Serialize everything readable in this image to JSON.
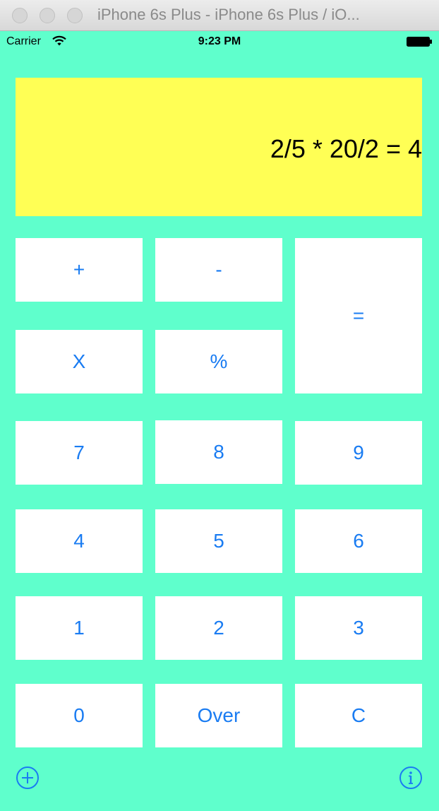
{
  "window": {
    "title": "iPhone 6s Plus - iPhone 6s Plus / iO..."
  },
  "status_bar": {
    "carrier": "Carrier",
    "time": "9:23 PM",
    "icons": [
      "wifi-icon",
      "battery-icon"
    ]
  },
  "display": {
    "expression": "2/5 * 20/2 = 4"
  },
  "keys": {
    "plus": "+",
    "minus": "-",
    "equals": "=",
    "multiply": "X",
    "percent": "%",
    "seven": "7",
    "eight": "8",
    "nine": "9",
    "four": "4",
    "five": "5",
    "six": "6",
    "one": "1",
    "two": "2",
    "three": "3",
    "zero": "0",
    "over": "Over",
    "clear": "C"
  },
  "toolbar": {
    "icons": [
      "add-circle-icon",
      "info-circle-icon"
    ]
  },
  "colors": {
    "background": "#5fffcc",
    "display": "#ffff55",
    "key_background": "#ffffff",
    "key_text": "#1a7cf2"
  }
}
